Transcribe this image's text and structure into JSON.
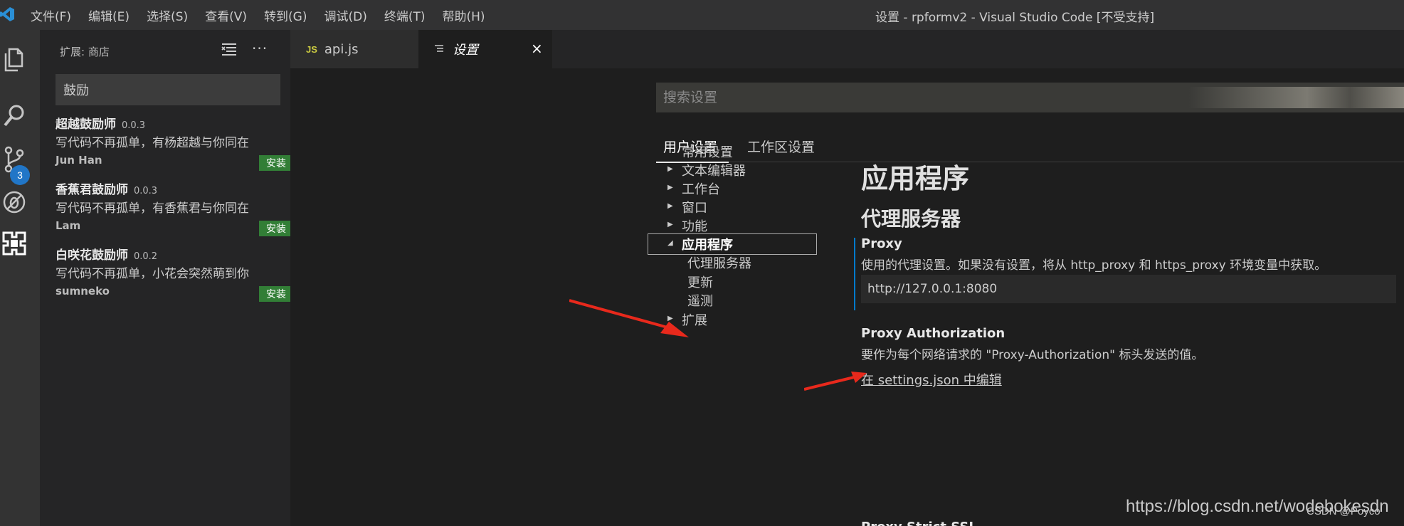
{
  "titlebar": {
    "menus": [
      "文件(F)",
      "编辑(E)",
      "选择(S)",
      "查看(V)",
      "转到(G)",
      "调试(D)",
      "终端(T)",
      "帮助(H)"
    ],
    "window_title": "设置 - rpformv2 - Visual Studio Code [不受支持]"
  },
  "activitybar": {
    "icons": [
      "explorer-icon",
      "search-icon",
      "source-control-icon",
      "debug-icon",
      "extensions-icon"
    ],
    "scm_badge": "3",
    "accent": "#2176c7"
  },
  "sidebar": {
    "title": "扩展: 商店",
    "search_value": "鼓励",
    "extensions": [
      {
        "name": "超越鼓励师",
        "version": "0.0.3",
        "description": "写代码不再孤单，有杨超越与你同在",
        "author": "Jun Han",
        "install_label": "安装"
      },
      {
        "name": "香蕉君鼓励师",
        "version": "0.0.3",
        "description": "写代码不再孤单，有香蕉君与你同在",
        "author": "Lam",
        "install_label": "安装"
      },
      {
        "name": "白咲花鼓励师",
        "version": "0.0.2",
        "description": "写代码不再孤单，小花会突然萌到你",
        "author": "sumneko",
        "install_label": "安装"
      }
    ],
    "install_color": "#327e36"
  },
  "tabs": {
    "api": {
      "icon": "JS",
      "label": "api.js"
    },
    "settings": {
      "label": "设置",
      "close": "×"
    }
  },
  "settings": {
    "search_placeholder": "搜索设置",
    "scope_user": "用户设置",
    "scope_workspace": "工作区设置",
    "toc": {
      "common": "常用设置",
      "text_editor": "文本编辑器",
      "workbench": "工作台",
      "window": "窗口",
      "features": "功能",
      "application": "应用程序",
      "proxy": "代理服务器",
      "update": "更新",
      "telemetry": "遥测",
      "extensions": "扩展"
    },
    "heading": "应用程序",
    "subheading": "代理服务器",
    "proxy": {
      "title": "Proxy",
      "description": "使用的代理设置。如果没有设置，将从 http_proxy 和 https_proxy 环境变量中获取。",
      "value": "http://127.0.0.1:8080"
    },
    "proxy_authorization": {
      "title": "Proxy Authorization",
      "description": "要作为每个网络请求的 \"Proxy-Authorization\" 标头发送的值。",
      "edit_link": "在 settings.json 中编辑"
    },
    "next_setting_title": "Proxy Strict SSL"
  },
  "watermarks": {
    "url": "https://blog.csdn.net/wodebokesdn",
    "csdn": "CSDN @Poyco"
  },
  "annotation_color": "#e8291c"
}
